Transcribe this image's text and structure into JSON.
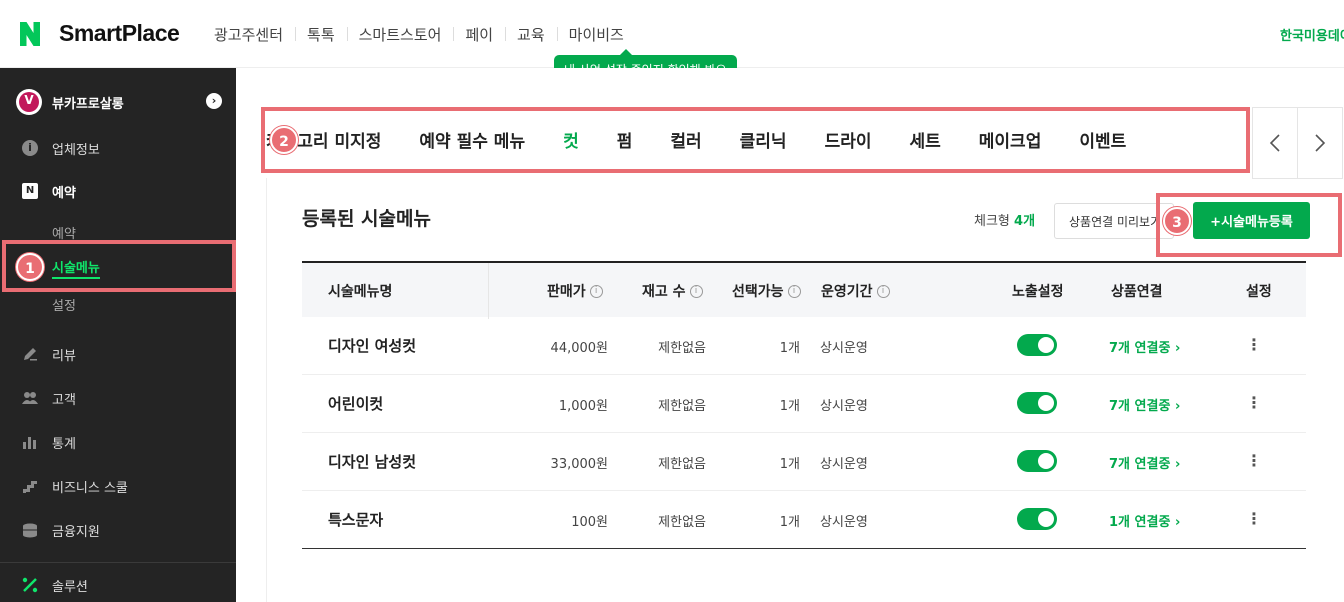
{
  "app": {
    "logo_letter": "N",
    "logo_text": "SmartPlace",
    "business_name": "한국미용데이"
  },
  "top_nav": [
    "광고주센터",
    "톡톡",
    "스마트스토어",
    "페이",
    "교육",
    "마이비즈"
  ],
  "tooltip": "내 사업 성장 중인지 확인해 봐요",
  "sidebar": {
    "shop_name": "뷰카프로살롱",
    "shop_logo_letter": "V",
    "items": [
      {
        "label": "업체정보",
        "icon": "info-icon"
      },
      {
        "label": "예약",
        "icon": "calendar-icon"
      },
      {
        "label": "리뷰",
        "icon": "pencil-icon"
      },
      {
        "label": "고객",
        "icon": "people-icon"
      },
      {
        "label": "통계",
        "icon": "chart-icon"
      },
      {
        "label": "비즈니스 스쿨",
        "icon": "stairs-icon"
      },
      {
        "label": "금융지원",
        "icon": "coins-icon"
      },
      {
        "label": "솔루션",
        "icon": "solution-icon"
      }
    ],
    "sub_items": [
      {
        "label": "예약",
        "active": false
      },
      {
        "label": "시술메뉴",
        "active": true
      },
      {
        "label": "설정",
        "active": false
      }
    ]
  },
  "category_tabs": [
    {
      "label": "카테고리 미지정",
      "active": false
    },
    {
      "label": "예약 필수 메뉴",
      "active": false
    },
    {
      "label": "컷",
      "active": true
    },
    {
      "label": "펌",
      "active": false
    },
    {
      "label": "컬러",
      "active": false
    },
    {
      "label": "클리닉",
      "active": false
    },
    {
      "label": "드라이",
      "active": false
    },
    {
      "label": "세트",
      "active": false
    },
    {
      "label": "메이크업",
      "active": false
    },
    {
      "label": "이벤트",
      "active": false
    }
  ],
  "section": {
    "title": "등록된 시술메뉴",
    "check_label": "체크형",
    "check_count": "4개",
    "preview_button": "상품연결 미리보기",
    "add_button": "+시술메뉴등록"
  },
  "table": {
    "headers": {
      "name": "시술메뉴명",
      "price": "판매가",
      "stock": "재고 수",
      "selectable": "선택가능",
      "period": "운영기간",
      "exposure": "노출설정",
      "link": "상품연결",
      "settings": "설정"
    },
    "rows": [
      {
        "name": "디자인 여성컷",
        "price": "44,000원",
        "stock": "제한없음",
        "selectable": "1개",
        "period": "상시운영",
        "exposed": true,
        "link": "7개 연결중"
      },
      {
        "name": "어린이컷",
        "price": "1,000원",
        "stock": "제한없음",
        "selectable": "1개",
        "period": "상시운영",
        "exposed": true,
        "link": "7개 연결중"
      },
      {
        "name": "디자인 남성컷",
        "price": "33,000원",
        "stock": "제한없음",
        "selectable": "1개",
        "period": "상시운영",
        "exposed": true,
        "link": "7개 연결중"
      },
      {
        "name": "특스문자",
        "price": "100원",
        "stock": "제한없음",
        "selectable": "1개",
        "period": "상시운영",
        "exposed": true,
        "link": "1개 연결중"
      }
    ]
  },
  "annotations": [
    "1",
    "2",
    "3"
  ],
  "colors": {
    "brand_green": "#03a94d",
    "highlight": "#e96d73",
    "sidebar_bg": "#242424"
  }
}
